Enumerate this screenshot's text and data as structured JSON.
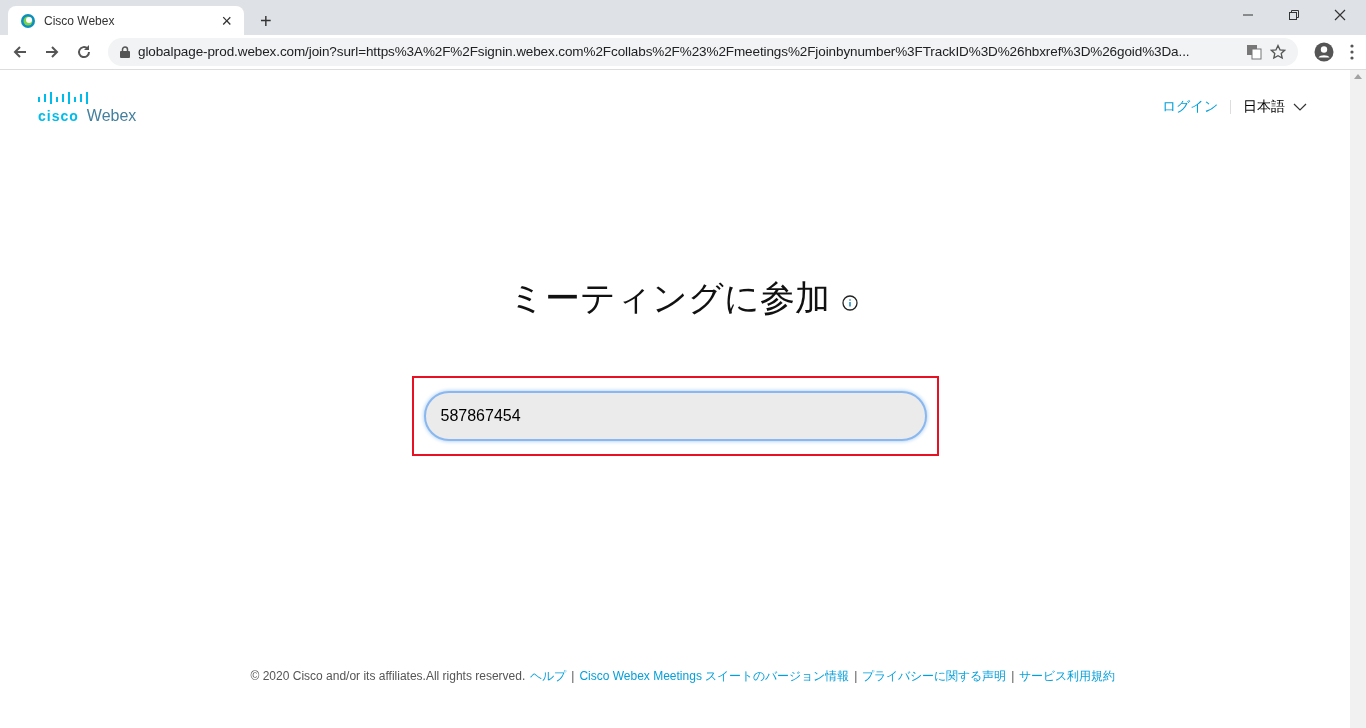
{
  "browser": {
    "tab": {
      "title": "Cisco Webex",
      "close": "×"
    },
    "new_tab": "+",
    "url": "globalpage-prod.webex.com/join?surl=https%3A%2F%2Fsignin.webex.com%2Fcollabs%2F%23%2Fmeetings%2Fjoinbynumber%3FTrackID%3D%26hbxref%3D%26goid%3Da..."
  },
  "header": {
    "logo_cisco": "cisco",
    "logo_webex": "Webex",
    "login": "ログイン",
    "language": "日本語"
  },
  "title": "ミーティングに参加",
  "meeting_field": {
    "value": "587867454"
  },
  "footer": {
    "copyright": "© 2020 Cisco and/or its affiliates.All rights reserved.",
    "links": [
      "ヘルプ",
      "Cisco Webex Meetings スイートのバージョン情報",
      "プライバシーに関する声明",
      "サービス利用規約"
    ],
    "separator": "|"
  }
}
